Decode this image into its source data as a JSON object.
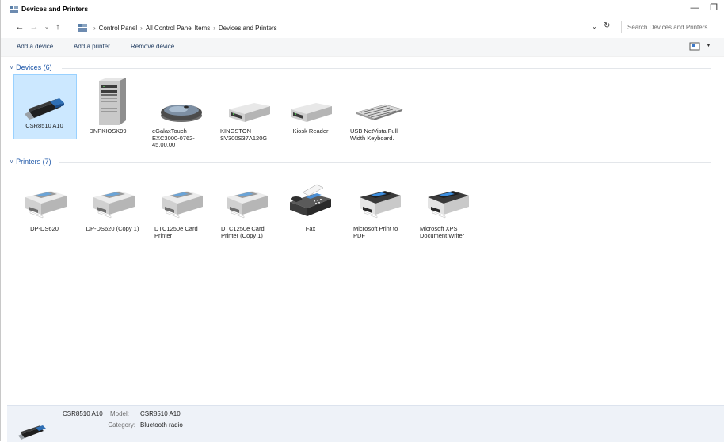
{
  "window": {
    "title": "Devices and Printers",
    "min": "—",
    "restore": "❐"
  },
  "nav": {
    "back": "←",
    "forward": "→",
    "recent": "⌄",
    "up": "↑",
    "dropdown": "⌄",
    "refresh": "↻"
  },
  "breadcrumb": [
    "Control Panel",
    "All Control Panel Items",
    "Devices and Printers"
  ],
  "search": {
    "placeholder": "Search Devices and Printers"
  },
  "commands": {
    "add_device": "Add a device",
    "add_printer": "Add a printer",
    "remove_device": "Remove device"
  },
  "groups": {
    "devices": {
      "label": "Devices (6)"
    },
    "printers": {
      "label": "Printers (7)"
    }
  },
  "devices": [
    {
      "label": "CSR8510 A10",
      "icon": "usb-dongle-icon"
    },
    {
      "label": "DNPKIOSK99",
      "icon": "computer-tower-icon"
    },
    {
      "label": "eGalaxTouch EXC3000-0762-45.00.00",
      "icon": "mouse-icon"
    },
    {
      "label": "KINGSTON SV300S37A120G",
      "icon": "drive-icon"
    },
    {
      "label": "Kiosk Reader",
      "icon": "drive-icon"
    },
    {
      "label": "USB NetVista Full Width Keyboard.",
      "icon": "keyboard-icon"
    }
  ],
  "printers": [
    {
      "label": "DP-DS620",
      "icon": "printer-icon"
    },
    {
      "label": "DP-DS620 (Copy 1)",
      "icon": "printer-icon"
    },
    {
      "label": "DTC1250e Card Printer",
      "icon": "printer-icon"
    },
    {
      "label": "DTC1250e Card Printer (Copy 1)",
      "icon": "printer-icon"
    },
    {
      "label": "Fax",
      "icon": "fax-icon"
    },
    {
      "label": "Microsoft Print to PDF",
      "icon": "printer-icon"
    },
    {
      "label": "Microsoft XPS Document Writer",
      "icon": "printer-icon"
    }
  ],
  "details": {
    "name": "CSR8510 A10",
    "model_key": "Model:",
    "model_val": "CSR8510 A10",
    "category_key": "Category:",
    "category_val": "Bluetooth radio"
  }
}
